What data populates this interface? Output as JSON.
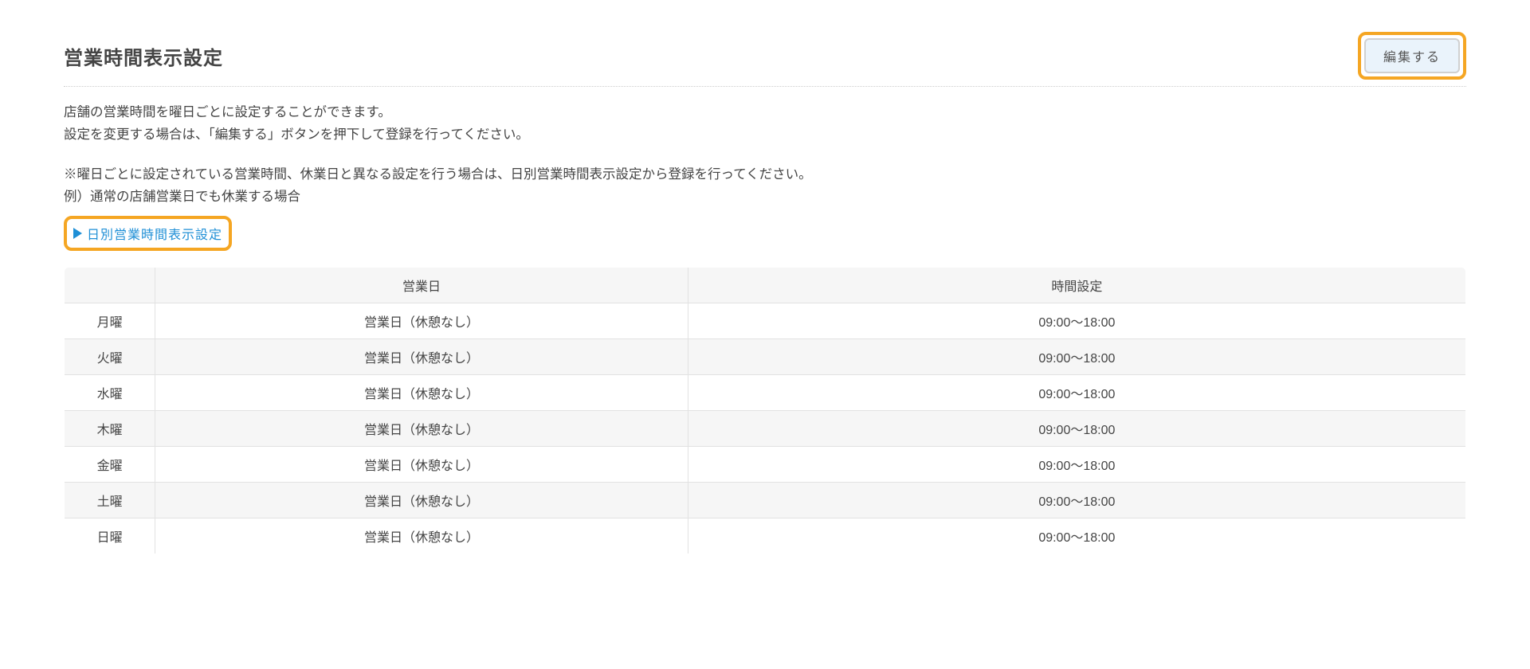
{
  "header": {
    "title": "営業時間表示設定",
    "edit_button": "編集する"
  },
  "description": {
    "line1": "店舗の営業時間を曜日ごとに設定することができます。",
    "line2": "設定を変更する場合は、「編集する」ボタンを押下して登録を行ってください。"
  },
  "note": {
    "line1": "※曜日ごとに設定されている営業時間、休業日と異なる設定を行う場合は、日別営業時間表示設定から登録を行ってください。",
    "line2": "例）通常の店舗営業日でも休業する場合"
  },
  "daily_link": {
    "label": "日別営業時間表示設定"
  },
  "table": {
    "headers": {
      "day": "",
      "status": "営業日",
      "time": "時間設定"
    },
    "rows": [
      {
        "day": "月曜",
        "status": "営業日（休憩なし）",
        "time": "09:00〜18:00"
      },
      {
        "day": "火曜",
        "status": "営業日（休憩なし）",
        "time": "09:00〜18:00"
      },
      {
        "day": "水曜",
        "status": "営業日（休憩なし）",
        "time": "09:00〜18:00"
      },
      {
        "day": "木曜",
        "status": "営業日（休憩なし）",
        "time": "09:00〜18:00"
      },
      {
        "day": "金曜",
        "status": "営業日（休憩なし）",
        "time": "09:00〜18:00"
      },
      {
        "day": "土曜",
        "status": "営業日（休憩なし）",
        "time": "09:00〜18:00"
      },
      {
        "day": "日曜",
        "status": "営業日（休憩なし）",
        "time": "09:00〜18:00"
      }
    ]
  }
}
